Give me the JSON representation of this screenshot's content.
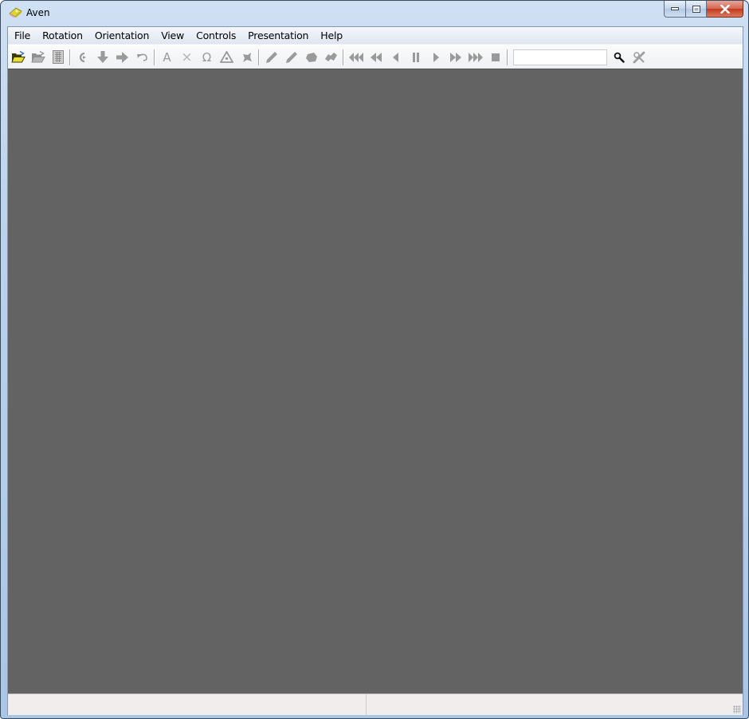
{
  "window": {
    "title": "Aven",
    "app_icon": "aven-app-icon",
    "controls": {
      "minimize": "minimize-icon",
      "maximize": "maximize-icon",
      "close": "close-icon"
    }
  },
  "menubar": {
    "items": [
      {
        "label": "File"
      },
      {
        "label": "Rotation"
      },
      {
        "label": "Orientation"
      },
      {
        "label": "View"
      },
      {
        "label": "Controls"
      },
      {
        "label": "Presentation"
      },
      {
        "label": "Help"
      }
    ]
  },
  "toolbar": {
    "groups": [
      [
        {
          "name": "open-file",
          "icon": "folder-open-icon",
          "enabled": true
        },
        {
          "name": "open-presentation",
          "icon": "folder-open-gray-icon",
          "enabled": false
        },
        {
          "name": "log-window",
          "icon": "grid-icon",
          "enabled": false
        }
      ],
      [
        {
          "name": "toggle-rotation",
          "icon": "rotate-icon",
          "enabled": false
        },
        {
          "name": "plan-view",
          "icon": "arrow-down-icon",
          "enabled": false
        },
        {
          "name": "elevation-view",
          "icon": "arrow-right-icon",
          "enabled": false
        },
        {
          "name": "defaults",
          "icon": "undo-icon",
          "enabled": false
        }
      ],
      [
        {
          "name": "station-names",
          "icon": "letter-a-icon",
          "glyph": "A",
          "enabled": false
        },
        {
          "name": "crosses",
          "icon": "cross-icon",
          "glyph": "×",
          "enabled": false
        },
        {
          "name": "entrances",
          "icon": "omega-icon",
          "glyph": "Ω",
          "enabled": false
        },
        {
          "name": "fixed-points",
          "icon": "triangle-icon",
          "enabled": false
        },
        {
          "name": "exported-points",
          "icon": "exported-icon",
          "enabled": false
        }
      ],
      [
        {
          "name": "underground-legs",
          "icon": "pencil-icon",
          "enabled": false
        },
        {
          "name": "surface-legs",
          "icon": "pencil-alt-icon",
          "enabled": false
        },
        {
          "name": "passage-tubes",
          "icon": "tube-icon",
          "enabled": false
        },
        {
          "name": "terrain",
          "icon": "terrain-icon",
          "enabled": false
        }
      ],
      [
        {
          "name": "go-to-start",
          "icon": "triple-left-icon",
          "enabled": false
        },
        {
          "name": "fast-backward",
          "icon": "double-left-icon",
          "enabled": false
        },
        {
          "name": "step-backward",
          "icon": "play-left-icon",
          "enabled": false
        },
        {
          "name": "pause",
          "icon": "pause-icon",
          "enabled": false
        },
        {
          "name": "play",
          "icon": "play-icon",
          "enabled": false
        },
        {
          "name": "fast-forward",
          "icon": "double-right-icon",
          "enabled": false
        },
        {
          "name": "go-to-end",
          "icon": "triple-right-icon",
          "enabled": false
        },
        {
          "name": "stop",
          "icon": "stop-icon",
          "enabled": false
        }
      ]
    ],
    "search": {
      "value": "",
      "placeholder": "",
      "find_icon": "magnifier-icon",
      "clear_icon": "clear-search-icon"
    }
  },
  "statusbar": {
    "panes": [
      {
        "text": ""
      },
      {
        "text": ""
      }
    ]
  },
  "colors": {
    "canvas_background": "#636363",
    "toolbar_icon_disabled": "#9a9a9a",
    "close_button": "#c4391f"
  }
}
